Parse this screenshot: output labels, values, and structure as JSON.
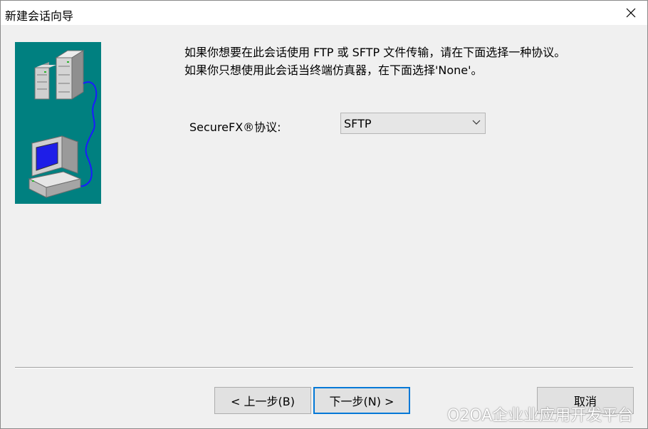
{
  "window": {
    "title": "新建会话向导"
  },
  "icons": {
    "close": "close-icon",
    "illustration": "server-computer-illustration",
    "dropdown": "chevron-down-icon"
  },
  "content": {
    "instruction_line1": "如果你想要在此会话使用 FTP 或 SFTP 文件传输，请在下面选择一种协议。",
    "instruction_line2": "如果你只想使用此会话当终端仿真器，在下面选择'None'。",
    "protocol_label": "SecureFX®协议:",
    "protocol_value": "SFTP"
  },
  "buttons": {
    "back": "< 上一步(B)",
    "next": "下一步(N) >",
    "cancel": "取消"
  },
  "watermark": "O2OA企业业应用开发平台",
  "colors": {
    "illustration_bg": "#008080",
    "default_button_border": "#0078d7",
    "dialog_bg": "#f0f0f0"
  }
}
